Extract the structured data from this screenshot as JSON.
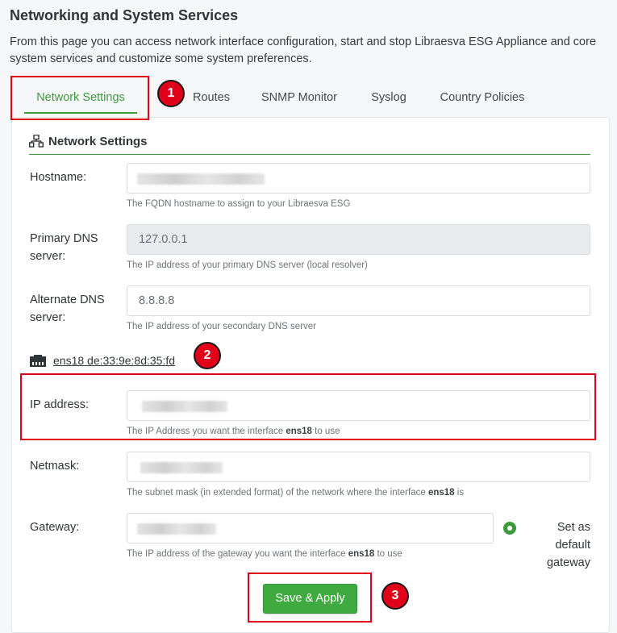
{
  "page": {
    "title": "Networking and System Services",
    "description": "From this page you can access network interface configuration, start and stop Libraesva ESG Appliance and core system services and customize some system preferences."
  },
  "tabs": [
    {
      "label": "Network Settings",
      "active": true
    },
    {
      "label": "Routes"
    },
    {
      "label": "SNMP Monitor"
    },
    {
      "label": "Syslog"
    },
    {
      "label": "Country Policies"
    }
  ],
  "annotations": [
    "1",
    "2",
    "3"
  ],
  "section": {
    "title": "Network Settings",
    "icon": "network-icon"
  },
  "fields": {
    "hostname": {
      "label": "Hostname:",
      "value": "",
      "help": "The FQDN hostname to assign to your Libraesva ESG"
    },
    "primary_dns": {
      "label": "Primary DNS server:",
      "value": "127.0.0.1",
      "help": "The IP address of your primary DNS server (local resolver)"
    },
    "alternate_dns": {
      "label": "Alternate DNS server:",
      "value": "8.8.8.8",
      "help": "The IP address of your secondary DNS server"
    }
  },
  "interface": {
    "name": "ens18 de:33:9e:8d:35:fd",
    "icon": "ethernet-port-icon",
    "ip": {
      "label": "IP address:",
      "help_pre": "The IP Address you want the interface ",
      "help_iface": "ens18",
      "help_post": " to use"
    },
    "netmask": {
      "label": "Netmask:",
      "help_pre": "The subnet mask (in extended format) of the network where the interface ",
      "help_iface": "ens18",
      "help_post": " is"
    },
    "gateway": {
      "label": "Gateway:",
      "help_pre": "The IP address of the gateway you want the interface ",
      "help_iface": "ens18",
      "help_post": " to use",
      "default_label": "Set as default gateway"
    }
  },
  "actions": {
    "save_label": "Save & Apply"
  },
  "colors": {
    "accent": "#3d9a3d",
    "annotation_red": "#e0001a"
  }
}
